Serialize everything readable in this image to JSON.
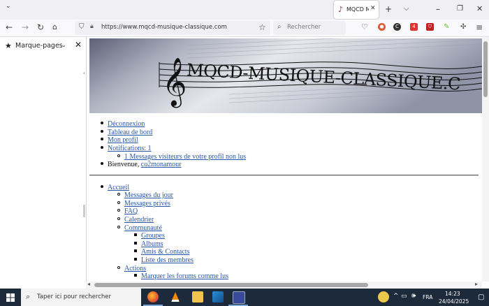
{
  "browser": {
    "tab_title": "MQCD M",
    "url": "https://www.mqcd-musique-classique.com",
    "search_placeholder": "Rechercher",
    "notification_badge": "4"
  },
  "sidebar": {
    "title": "Marque-pages"
  },
  "page": {
    "banner_text": "MQCD-MUSIQUE-CLASSIQUE.C",
    "user_menu": [
      {
        "label": "Déconnexion"
      },
      {
        "label": "Tableau de bord"
      },
      {
        "label": "Mon profil"
      },
      {
        "label": "Notifications: 1"
      }
    ],
    "notification_sub": "1 Messages visiteurs de votre profil non lus",
    "welcome_prefix": "Bienvenue,",
    "username": "co2monamour",
    "nav": {
      "home": "Accueil",
      "items": [
        {
          "label": "Messages du jour"
        },
        {
          "label": "Messages privés"
        },
        {
          "label": "FAQ"
        },
        {
          "label": "Calendrier"
        },
        {
          "label": "Communauté"
        }
      ],
      "community": [
        {
          "label": "Groupes"
        },
        {
          "label": "Albums"
        },
        {
          "label": "Amis & Contacts"
        },
        {
          "label": "Liste des membres"
        }
      ],
      "actions": "Actions",
      "actions_items": [
        {
          "label": "Marquer les forums comme lus"
        }
      ]
    }
  },
  "taskbar": {
    "search_placeholder": "Taper ici pour rechercher",
    "language": "FRA",
    "time": "14:23",
    "date": "24/04/2025"
  },
  "colors": {
    "link": "#2855a8",
    "taskbar": "#1c2a3b",
    "tab_strip": "#f0f0f4"
  }
}
